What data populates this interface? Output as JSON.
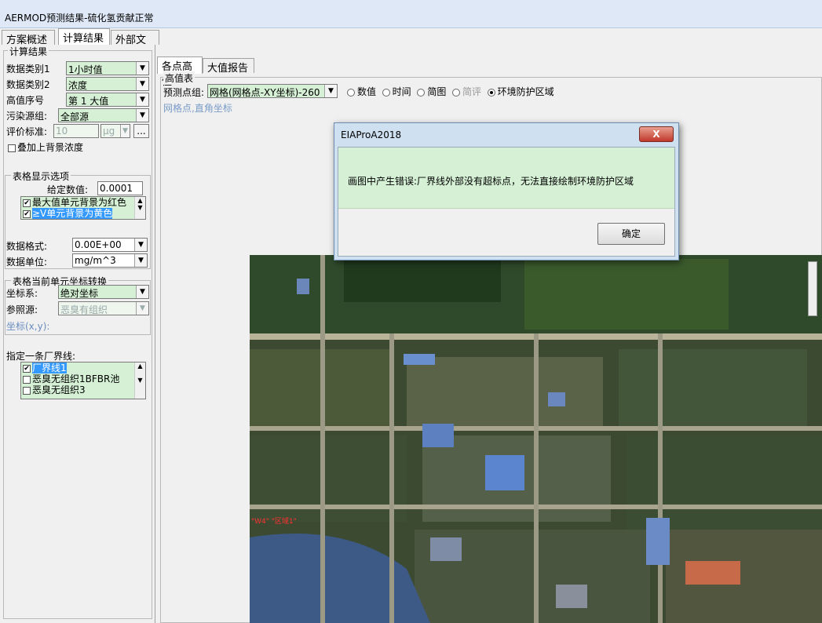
{
  "window": {
    "title": "AERMOD预测结果-硫化氢贡献正常"
  },
  "main_tabs": [
    "方案概述",
    "计算结果",
    "外部文件"
  ],
  "left": {
    "group_title": "计算结果",
    "rows": [
      {
        "label": "数据类别1",
        "value": "1小时值"
      },
      {
        "label": "数据类别2",
        "value": "浓度"
      },
      {
        "label": "高值序号",
        "value": "第 1 大值"
      },
      {
        "label": "污染源组:",
        "value": "全部源"
      }
    ],
    "eval_label": "评价标准:",
    "eval_value": "10",
    "eval_unit": "μg",
    "eval_more": "...",
    "background_checkbox": "叠加上背景浓度",
    "table_group": "表格显示选项",
    "given_label": "给定数值:",
    "given_value": "0.0001",
    "color_items": [
      "最大值单元背景为红色",
      "≥V单元背景为黄色"
    ],
    "format_label": "数据格式:",
    "format_value": "0.00E+00",
    "unit_label": "数据单位:",
    "unit_value": "mg/m^3",
    "coord_group": "表格当前单元坐标转换",
    "coord_sys_label": "坐标系:",
    "coord_sys_value": "绝对坐标",
    "ref_label": "参照源:",
    "ref_value": "恶臭有组织",
    "coord_xy": "坐标(x,y):",
    "boundary_label": "指定一条厂界线:",
    "boundary_items": [
      "厂界线1",
      "恶臭无组织1BFBR池",
      "恶臭无组织3"
    ]
  },
  "right": {
    "tabs": [
      "各点高值",
      "大值报告"
    ],
    "group_title": "高值表",
    "pred_label": "预测点组:",
    "pred_value": "网格(网格点-XY坐标)-260",
    "radios": [
      "数值",
      "时间",
      "简图",
      "简评",
      "环境防护区域"
    ],
    "radio_checked": "环境防护区域",
    "subtitle": "网格点,直角坐标"
  },
  "dialog": {
    "title": "EIAProA2018",
    "close": "X",
    "message": "画图中产生错误:厂界线外部没有超标点，无法直接绘制环境防护区域",
    "ok": "确定"
  },
  "map": {
    "label": "\"W4\" \"区域1\""
  }
}
